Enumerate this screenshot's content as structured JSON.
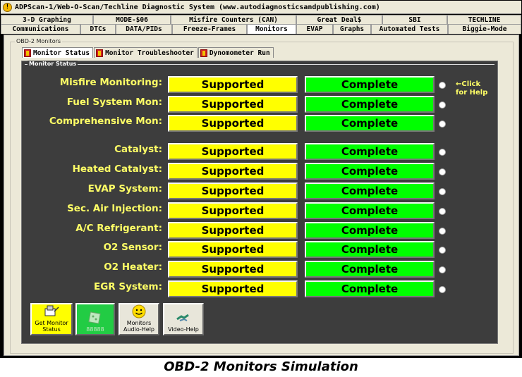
{
  "window": {
    "title": "ADPScan-1/Web-O-Scan/Techline Diagnostic System    (www.autodiagnosticsandpublishing.com)",
    "title_icon": "info-icon"
  },
  "tabs_row1": [
    "3-D Graphing",
    "MODE-$06",
    "Misfire Counters (CAN)",
    "Great Deal$",
    "SBI",
    "TECHLINE"
  ],
  "tabs_row2": [
    "Communications",
    "DTCs",
    "DATA/PIDs",
    "Freeze-Frames",
    "Monitors",
    "EVAP",
    "Graphs",
    "Automated Tests",
    "Biggie-Mode"
  ],
  "active_tab": "Monitors",
  "group_label": "OBD-2 Monitors",
  "subtabs": [
    "Monitor Status",
    "Monitor Troubleshooter",
    "Dynomometer Run"
  ],
  "active_subtab": "Monitor Status",
  "panel_label": "Monitor Status",
  "help_note": [
    "←Click",
    "for Help"
  ],
  "monitors": [
    {
      "name": "Misfire Monitoring:",
      "support": "Supported",
      "status": "Complete"
    },
    {
      "name": "Fuel System Mon:",
      "support": "Supported",
      "status": "Complete"
    },
    {
      "name": "Comprehensive Mon:",
      "support": "Supported",
      "status": "Complete"
    },
    {
      "name": "Catalyst:",
      "support": "Supported",
      "status": "Complete"
    },
    {
      "name": "Heated  Catalyst:",
      "support": "Supported",
      "status": "Complete"
    },
    {
      "name": "EVAP System:",
      "support": "Supported",
      "status": "Complete"
    },
    {
      "name": "Sec. Air Injection:",
      "support": "Supported",
      "status": "Complete"
    },
    {
      "name": "A/C Refrigerant:",
      "support": "Supported",
      "status": "Complete"
    },
    {
      "name": "O2 Sensor:",
      "support": "Supported",
      "status": "Complete"
    },
    {
      "name": "O2 Heater:",
      "support": "Supported",
      "status": "Complete"
    },
    {
      "name": "EGR System:",
      "support": "Supported",
      "status": "Complete"
    }
  ],
  "buttons": {
    "get_status": "Get Monitor Status",
    "disabled": "88888",
    "audio_help": "Monitors Audio-Help",
    "video_help": "Video-Help"
  },
  "caption": "OBD-2 Monitors Simulation",
  "colors": {
    "supported": "#ffff00",
    "complete": "#00ff00",
    "panel": "#3d3d3d",
    "label": "#ffff66"
  }
}
